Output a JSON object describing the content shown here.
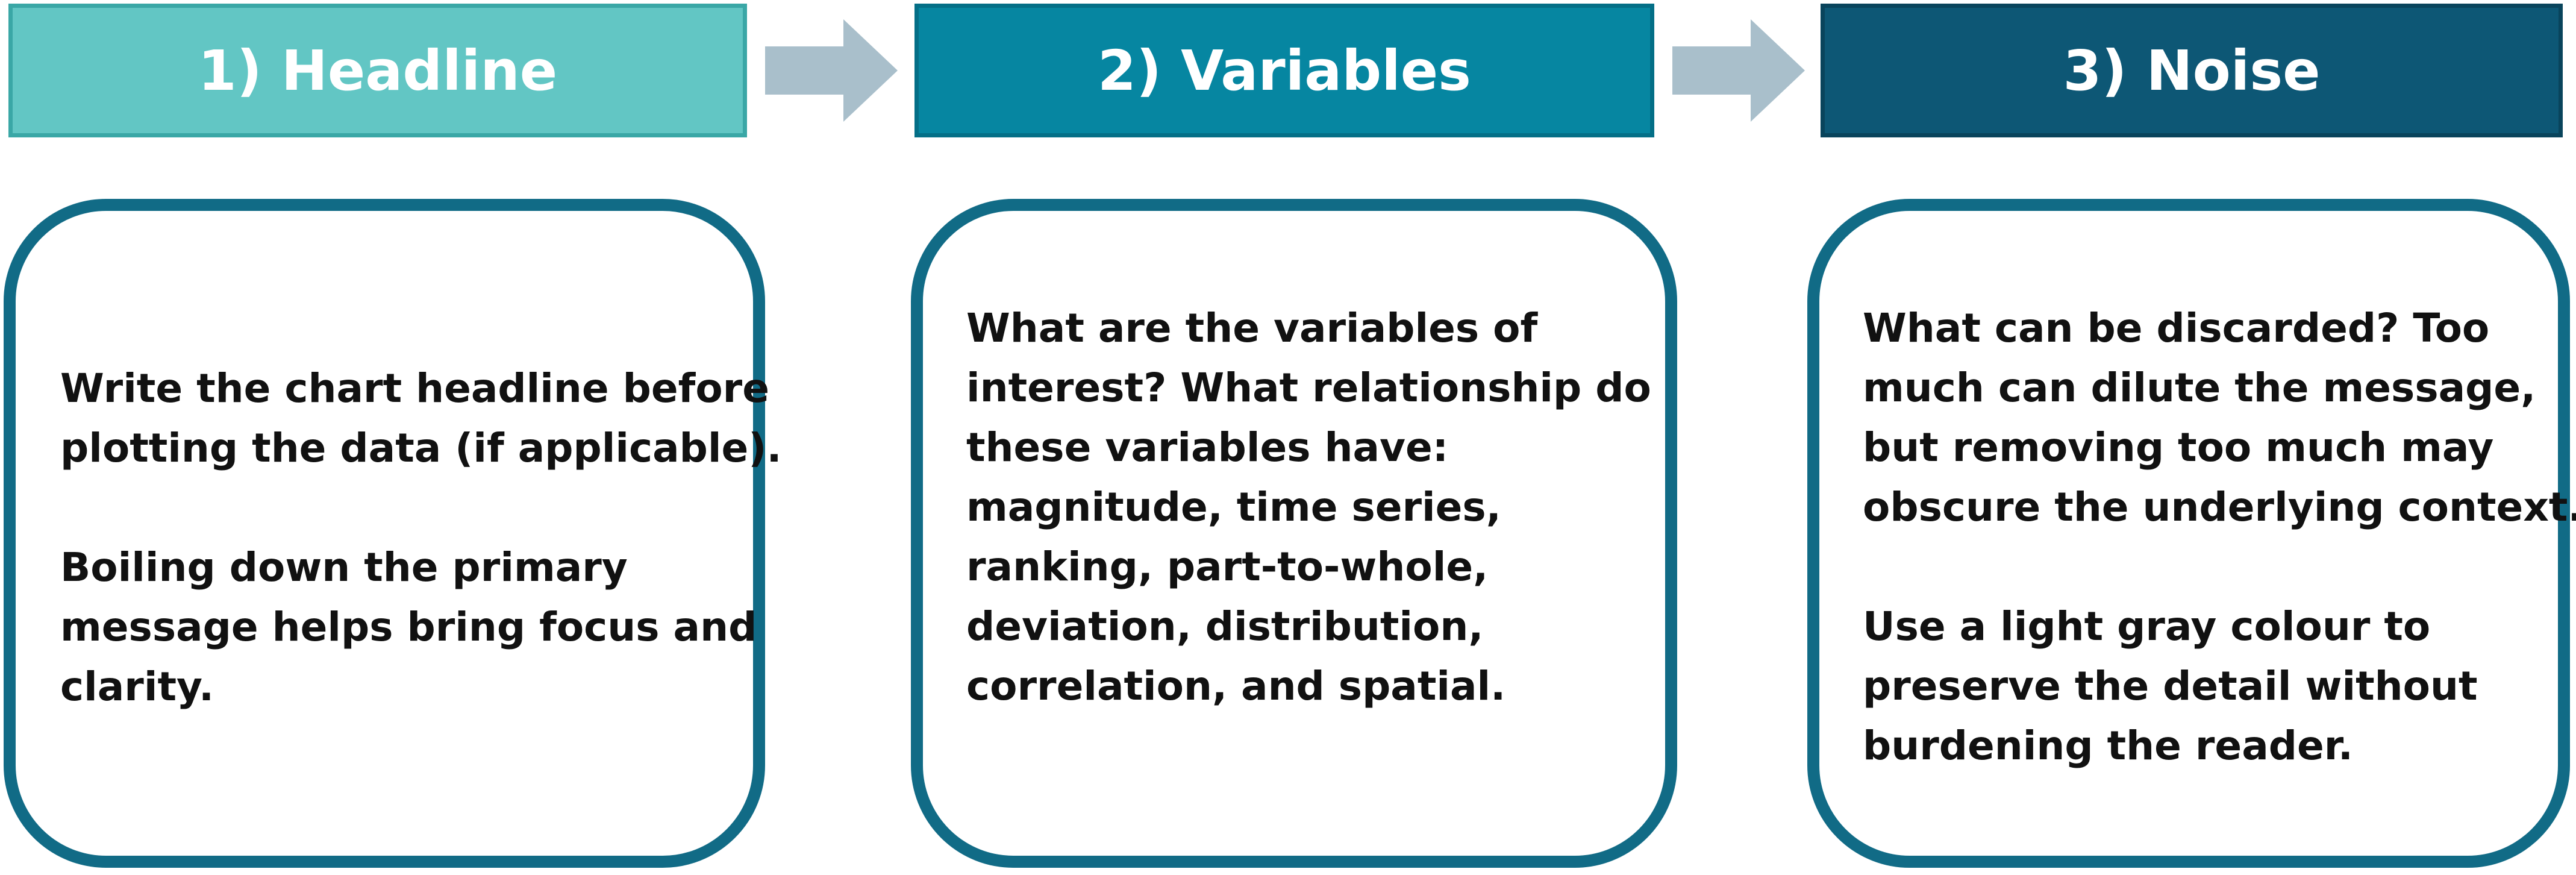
{
  "steps": [
    {
      "title": "1) Headline",
      "paragraphs": [
        [
          "Write the chart headline before",
          "plotting the data (if applicable)."
        ],
        [
          "Boiling down the primary",
          "message helps bring focus and",
          "clarity."
        ]
      ]
    },
    {
      "title": "2) Variables",
      "paragraphs": [
        [
          "What are the variables of",
          "interest? What relationship do",
          "these variables have:",
          "magnitude, time series,",
          "ranking, part-to-whole,",
          "deviation, distribution,",
          "correlation, and spatial."
        ]
      ]
    },
    {
      "title": "3) Noise",
      "paragraphs": [
        [
          "What can be discarded? Too",
          "much can dilute the message,",
          "but removing too much may",
          "obscure the underlying context."
        ],
        [
          "Use a light gray colour to",
          "preserve the detail without",
          "burdening the reader."
        ]
      ]
    }
  ],
  "colors": {
    "step1_header": "#62c6c4",
    "step2_header": "#0686a1",
    "step3_header": "#0d5775",
    "arrow": "#a9bfcb",
    "box_border": "#116b86",
    "text": "#111111"
  }
}
